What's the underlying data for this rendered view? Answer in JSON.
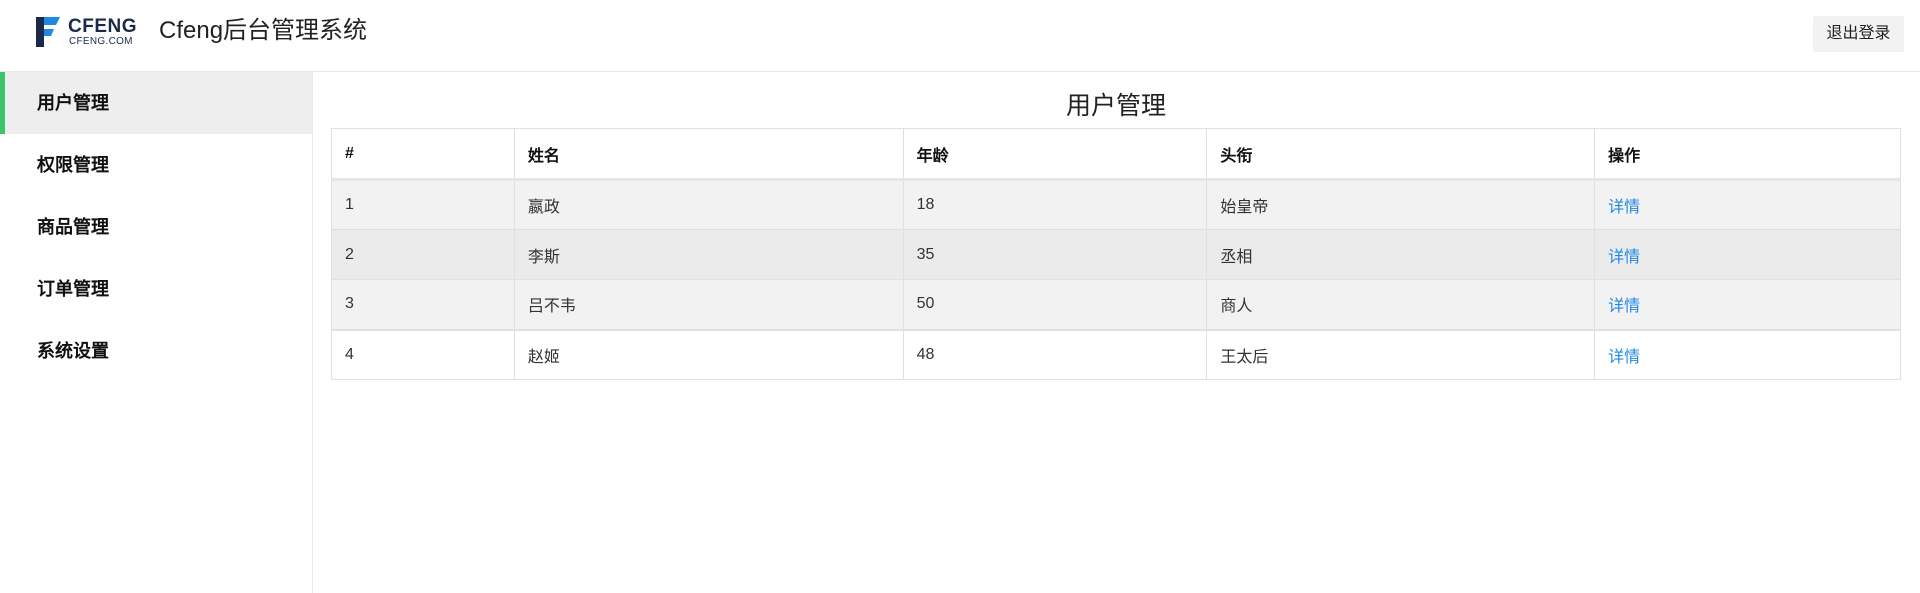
{
  "header": {
    "logo_text": "CFENG",
    "logo_subtext": "CFENG.COM",
    "app_title": "Cfeng后台管理系统",
    "logout_label": "退出登录"
  },
  "sidebar": {
    "items": [
      {
        "label": "用户管理",
        "active": true
      },
      {
        "label": "权限管理",
        "active": false
      },
      {
        "label": "商品管理",
        "active": false
      },
      {
        "label": "订单管理",
        "active": false
      },
      {
        "label": "系统设置",
        "active": false
      }
    ]
  },
  "main": {
    "title": "用户管理",
    "table": {
      "headers": [
        "#",
        "姓名",
        "年龄",
        "头衔",
        "操作"
      ],
      "rows": [
        {
          "id": "1",
          "name": "嬴政",
          "age": "18",
          "title": "始皇帝",
          "action": "详情"
        },
        {
          "id": "2",
          "name": "李斯",
          "age": "35",
          "title": "丞相",
          "action": "详情"
        },
        {
          "id": "3",
          "name": "吕不韦",
          "age": "50",
          "title": "商人",
          "action": "详情"
        },
        {
          "id": "4",
          "name": "赵姬",
          "age": "48",
          "title": "王太后",
          "action": "详情"
        }
      ]
    }
  },
  "colors": {
    "accent": "#3ec46d",
    "link": "#1e88e5",
    "logo": "#1b2a4a"
  }
}
